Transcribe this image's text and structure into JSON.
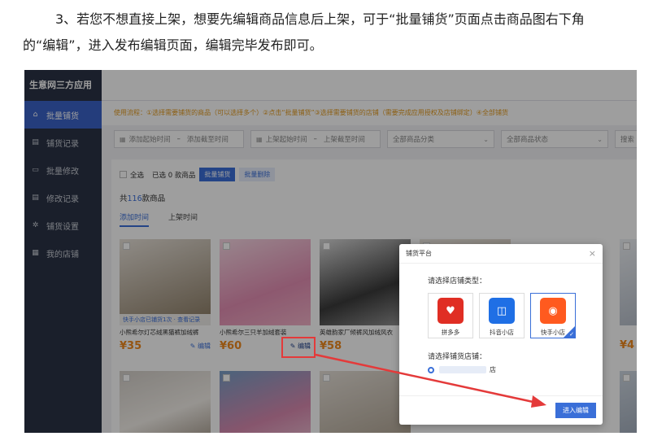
{
  "instruction": {
    "line1": "3、若您不想直接上架，想要先编辑商品信息后上架，可于“批量铺货”页面点击商品图右下角",
    "line2": "的“编辑”，进入发布编辑页面，编辑完毕发布即可。"
  },
  "app": {
    "title": "生意网三方应用",
    "sidebar": [
      {
        "icon": "home-icon",
        "glyph": "⌂",
        "label": "批量铺货",
        "active": true
      },
      {
        "icon": "list-icon",
        "glyph": "▤",
        "label": "铺货记录",
        "active": false
      },
      {
        "icon": "edit-icon",
        "glyph": "▭",
        "label": "批量修改",
        "active": false
      },
      {
        "icon": "record-icon",
        "glyph": "▤",
        "label": "修改记录",
        "active": false
      },
      {
        "icon": "gear-icon",
        "glyph": "✲",
        "label": "铺货设置",
        "active": false
      },
      {
        "icon": "shop-icon",
        "glyph": "▦",
        "label": "我的店铺",
        "active": false
      }
    ],
    "notice": "使用流程：①选择需要铺货的商品（可以选择多个）②点击“批量铺货”③选择需要铺货的店铺（需要完成应用授权及店铺绑定）④全部铺货",
    "filters": {
      "add_start": "添加起始时间",
      "add_end": "添加截至时间",
      "list_start": "上架起始时间",
      "list_end": "上架截至时间",
      "category": "全部商品分类",
      "status": "全部商品状态",
      "search": "搜索"
    },
    "selbar": {
      "select_all": "全选",
      "selected": "已选 0 款商品",
      "batch_btn": "批量铺货",
      "delete_btn": "批量删除"
    },
    "total": {
      "prefix": "共",
      "count": "116",
      "suffix": "款商品"
    },
    "tabs": [
      "添加时间",
      "上架时间"
    ],
    "products": [
      {
        "name": "小熊希尔灯芯绒黑猫裤加绒裤",
        "price": "¥35",
        "edit": "编辑",
        "banner": "快手小店已铺货1次 · 查看记录"
      },
      {
        "name": "小熊希尔三只羊加绒套装",
        "price": "¥60",
        "edit": "编辑"
      },
      {
        "name": "英雄韵家厂倾裤风加绒风衣",
        "price": "¥58",
        "edit": "编辑"
      },
      {
        "name": "",
        "price": "",
        "edit": ""
      },
      {
        "name": "",
        "price": "¥4",
        "edit": ""
      }
    ],
    "modal": {
      "title": "铺货平台",
      "shop_type_label": "请选择店铺类型：",
      "platforms": [
        {
          "name": "拼多多",
          "color": "#e02e24",
          "glyph": "♥"
        },
        {
          "name": "抖音小店",
          "color": "#1f6fe5",
          "glyph": "◫"
        },
        {
          "name": "快手小店",
          "color": "#ff5a1f",
          "glyph": "◉"
        }
      ],
      "shop_label": "请选择铺货店铺：",
      "shop_suffix": "店",
      "enter_btn": "进入编辑"
    }
  }
}
